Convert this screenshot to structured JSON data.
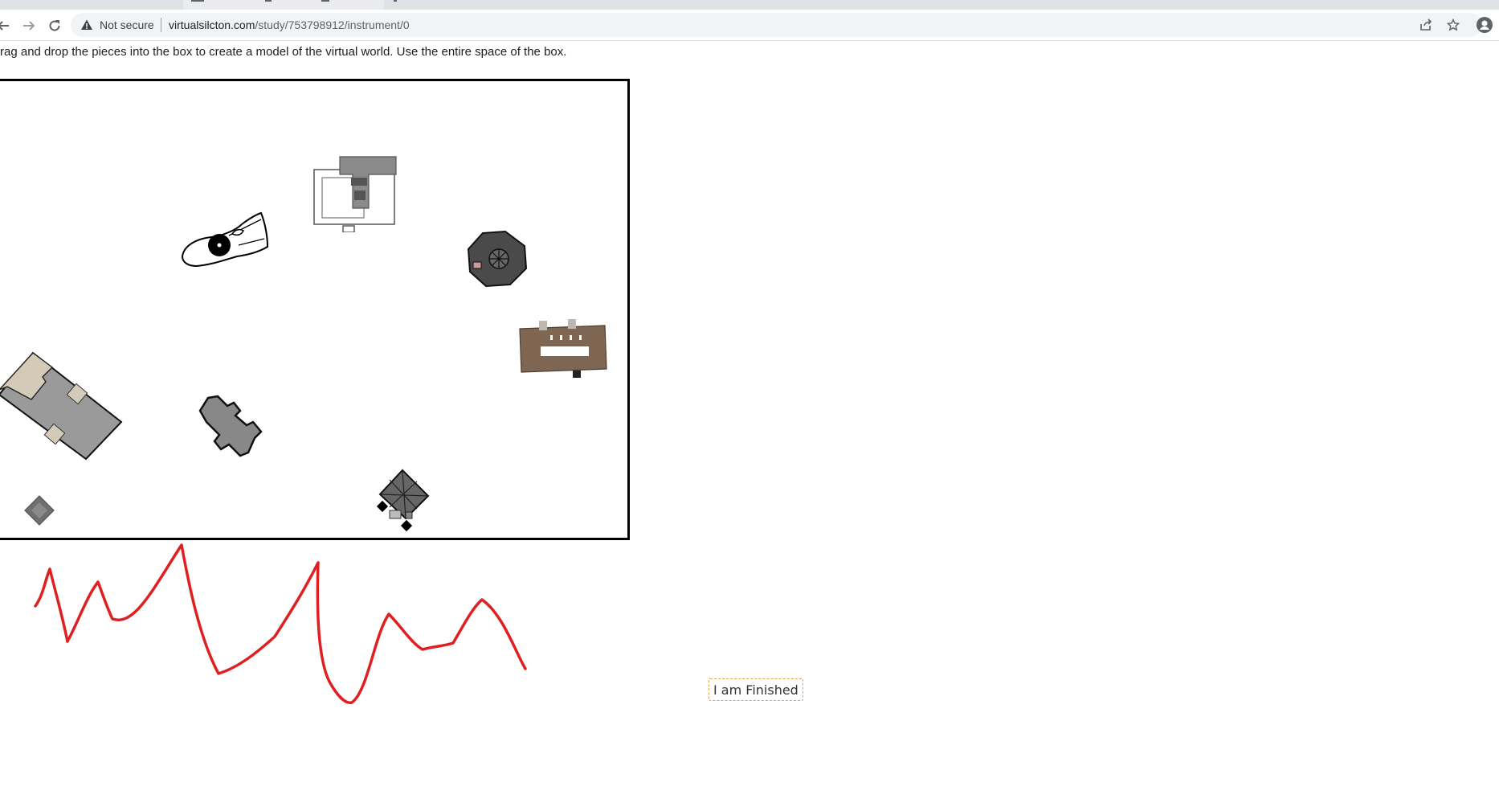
{
  "browser": {
    "security_label": "Not secure",
    "url_host": "virtualsilcton.com",
    "url_path": "/study/753798912/instrument/0"
  },
  "page": {
    "instructions": "rag and drop the pieces into the box to create a model of the virtual world. Use the entire space of the box.",
    "finish_button": "I am Finished"
  },
  "pieces": [
    {
      "name": "white-outline-building"
    },
    {
      "name": "t-shaped-gray-building"
    },
    {
      "name": "dark-octagonal-building"
    },
    {
      "name": "brown-rectangular-building"
    },
    {
      "name": "beige-gray-large-building"
    },
    {
      "name": "cross-shaped-gray-building"
    },
    {
      "name": "small-gray-building"
    },
    {
      "name": "gray-pyramid-roof-building"
    }
  ],
  "colors": {
    "scribble": "#e02020",
    "finish_border": "#e8a34a"
  }
}
